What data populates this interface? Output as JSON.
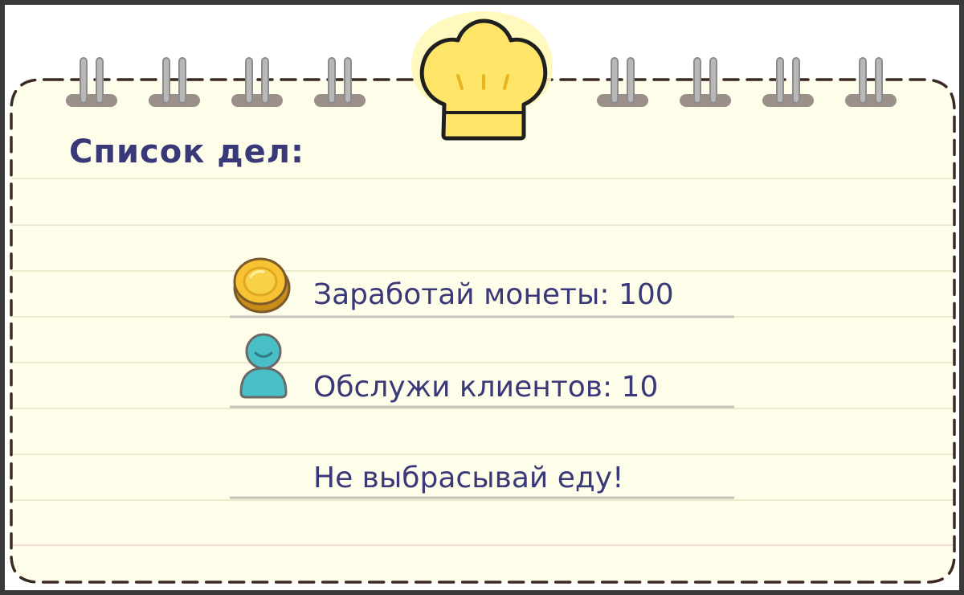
{
  "board": {
    "title": "Список дел:",
    "header_icon": "chef-hat-icon",
    "colors": {
      "paper": "#fefde9",
      "ink": "#393979",
      "border": "#3b2a22",
      "line": "#ece9cc",
      "hat_fill": "#ffe46a",
      "hat_outline": "#1f1f1f",
      "coin": "#f7c233",
      "person": "#49c0c7"
    }
  },
  "tasks": [
    {
      "icon": "coin-icon",
      "text": "Заработай монеты: 100"
    },
    {
      "icon": "person-icon",
      "text": "Обслужи клиентов: 10"
    },
    {
      "icon": "",
      "text": "Не выбрасывай еду!"
    }
  ]
}
